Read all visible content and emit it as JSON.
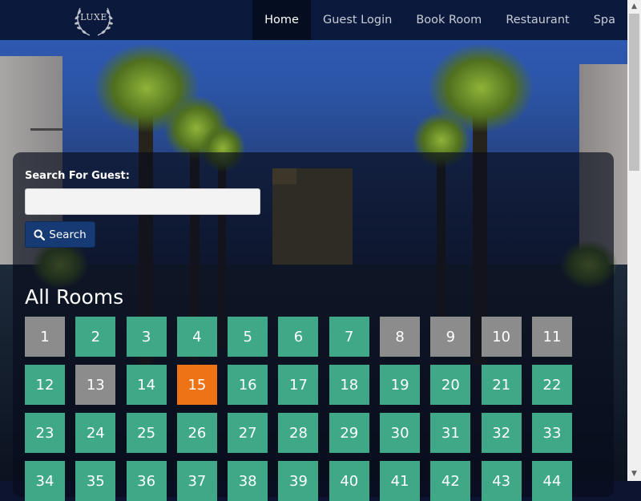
{
  "nav": {
    "logo_text": "LUXE",
    "items": [
      {
        "label": "Home",
        "active": true
      },
      {
        "label": "Guest Login",
        "active": false
      },
      {
        "label": "Book Room",
        "active": false
      },
      {
        "label": "Restaurant",
        "active": false
      },
      {
        "label": "Spa",
        "active": false
      }
    ]
  },
  "search": {
    "label": "Search For Guest:",
    "value": "",
    "button_label": "Search"
  },
  "rooms": {
    "title": "All Rooms",
    "colors": {
      "available": "#3fa886",
      "occupied": "#8c8c8c",
      "selected": "#ee7314"
    },
    "items": [
      {
        "number": "1",
        "status": "occupied"
      },
      {
        "number": "2",
        "status": "available"
      },
      {
        "number": "3",
        "status": "available"
      },
      {
        "number": "4",
        "status": "available"
      },
      {
        "number": "5",
        "status": "available"
      },
      {
        "number": "6",
        "status": "available"
      },
      {
        "number": "7",
        "status": "available"
      },
      {
        "number": "8",
        "status": "occupied"
      },
      {
        "number": "9",
        "status": "occupied"
      },
      {
        "number": "10",
        "status": "occupied"
      },
      {
        "number": "11",
        "status": "occupied"
      },
      {
        "number": "12",
        "status": "available"
      },
      {
        "number": "13",
        "status": "occupied"
      },
      {
        "number": "14",
        "status": "available"
      },
      {
        "number": "15",
        "status": "selected"
      },
      {
        "number": "16",
        "status": "available"
      },
      {
        "number": "17",
        "status": "available"
      },
      {
        "number": "18",
        "status": "available"
      },
      {
        "number": "19",
        "status": "available"
      },
      {
        "number": "20",
        "status": "available"
      },
      {
        "number": "21",
        "status": "available"
      },
      {
        "number": "22",
        "status": "available"
      },
      {
        "number": "23",
        "status": "available"
      },
      {
        "number": "24",
        "status": "available"
      },
      {
        "number": "25",
        "status": "available"
      },
      {
        "number": "26",
        "status": "available"
      },
      {
        "number": "27",
        "status": "available"
      },
      {
        "number": "28",
        "status": "available"
      },
      {
        "number": "29",
        "status": "available"
      },
      {
        "number": "30",
        "status": "available"
      },
      {
        "number": "31",
        "status": "available"
      },
      {
        "number": "32",
        "status": "available"
      },
      {
        "number": "33",
        "status": "available"
      },
      {
        "number": "34",
        "status": "available"
      },
      {
        "number": "35",
        "status": "available"
      },
      {
        "number": "36",
        "status": "available"
      },
      {
        "number": "37",
        "status": "available"
      },
      {
        "number": "38",
        "status": "available"
      },
      {
        "number": "39",
        "status": "available"
      },
      {
        "number": "40",
        "status": "available"
      },
      {
        "number": "41",
        "status": "available"
      },
      {
        "number": "42",
        "status": "available"
      },
      {
        "number": "43",
        "status": "available"
      },
      {
        "number": "44",
        "status": "available"
      }
    ]
  }
}
